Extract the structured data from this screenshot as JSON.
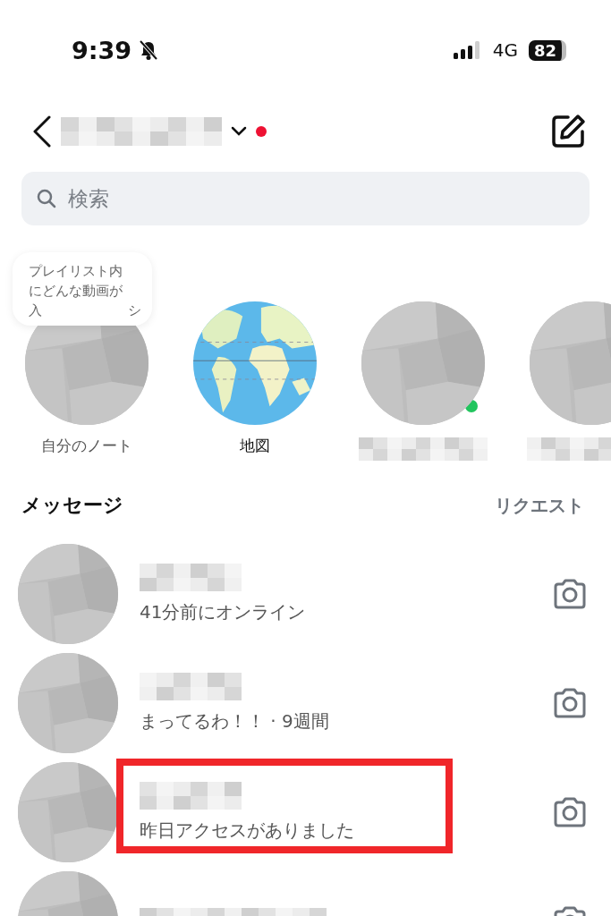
{
  "status_bar": {
    "time": "9:39",
    "silent": true,
    "network": "4G",
    "battery": "82"
  },
  "header": {
    "unread_dot": true
  },
  "search": {
    "placeholder": "検索"
  },
  "note_bubble": {
    "lines": [
      "プレイリスト内",
      "にどんな動画が"
    ],
    "partial_line": [
      "入",
      "シ"
    ]
  },
  "stories": [
    {
      "kind": "self",
      "label": "自分のノート",
      "online": false
    },
    {
      "kind": "map",
      "label": "地図",
      "online": false
    },
    {
      "kind": "user",
      "online": true
    },
    {
      "kind": "user"
    }
  ],
  "messages_section": {
    "title": "メッセージ",
    "requests": "リクエスト"
  },
  "conversations": [
    {
      "subtitle": "41分前にオンライン",
      "highlighted": false
    },
    {
      "subtitle": "まってるわ！！ · 9週間",
      "highlighted": false
    },
    {
      "subtitle": "昨日アクセスがありました",
      "highlighted": true
    },
    {
      "highlighted": false
    }
  ]
}
